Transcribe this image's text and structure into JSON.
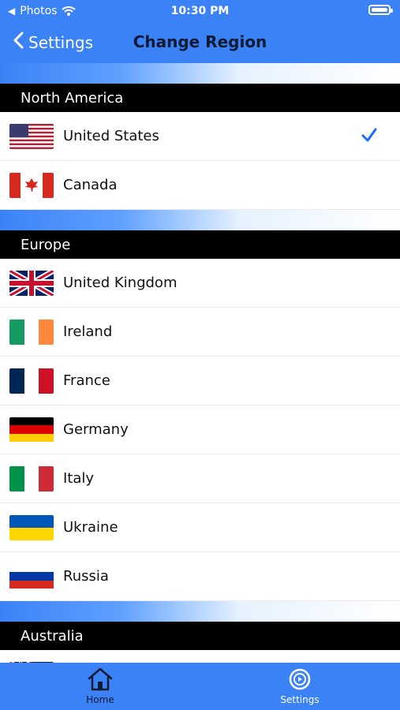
{
  "status": {
    "back_app": "Photos",
    "time": "10:30 PM"
  },
  "nav": {
    "back_label": "Settings",
    "title": "Change Region"
  },
  "sections": [
    {
      "title": "North America",
      "rows": [
        {
          "label": "United States",
          "flag": "us-flag",
          "selected": true
        },
        {
          "label": "Canada",
          "flag": "canada-flag",
          "selected": false
        }
      ]
    },
    {
      "title": "Europe",
      "rows": [
        {
          "label": "United Kingdom",
          "flag": "uk-flag",
          "selected": false
        },
        {
          "label": "Ireland",
          "flag": "ireland-flag",
          "selected": false
        },
        {
          "label": "France",
          "flag": "france-flag",
          "selected": false
        },
        {
          "label": "Germany",
          "flag": "germany-flag",
          "selected": false
        },
        {
          "label": "Italy",
          "flag": "italy-flag",
          "selected": false
        },
        {
          "label": "Ukraine",
          "flag": "ukraine-flag",
          "selected": false
        },
        {
          "label": "Russia",
          "flag": "russia-flag",
          "selected": false
        }
      ]
    },
    {
      "title": "Australia",
      "rows": []
    }
  ],
  "tabbar": {
    "home": "Home",
    "settings": "Settings"
  },
  "colors": {
    "accent": "#3b82f6",
    "check": "#1e6bff"
  }
}
